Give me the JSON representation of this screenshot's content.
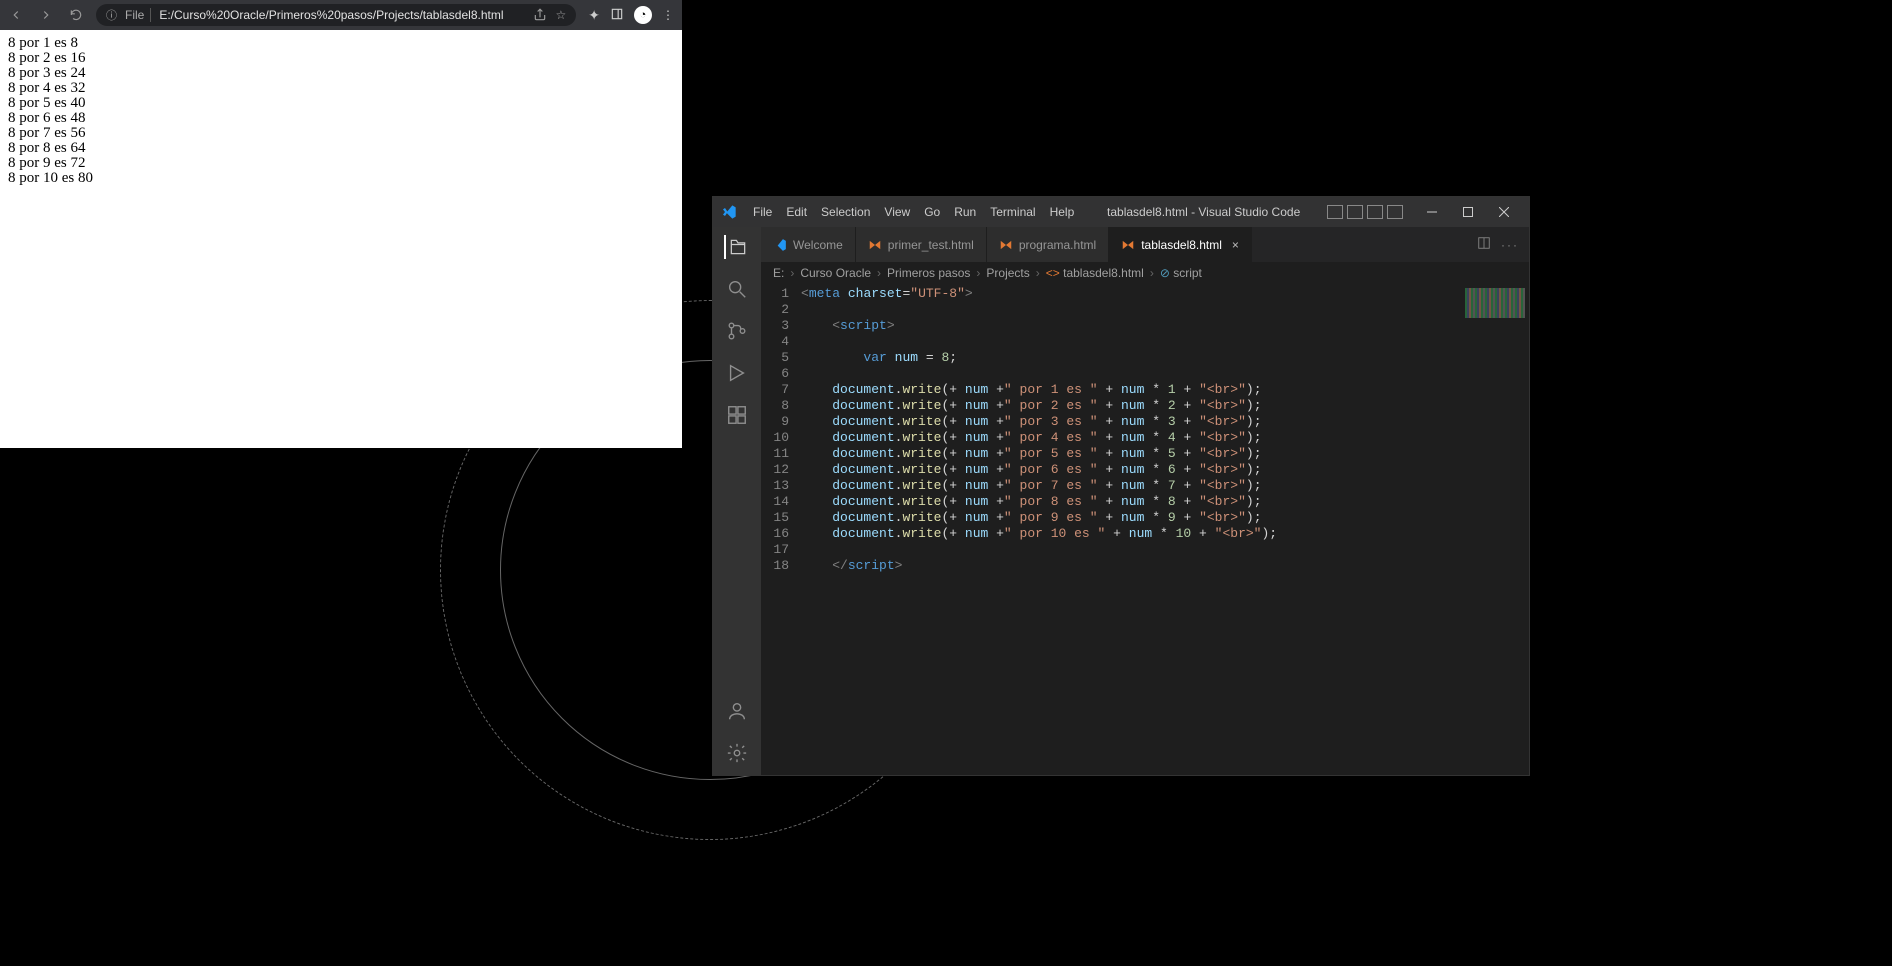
{
  "browser": {
    "url": "E:/Curso%20Oracle/Primeros%20pasos/Projects/tablasdel8.html",
    "file_badge": "File",
    "output_lines": [
      "8 por 1 es 8",
      "8 por 2 es 16",
      "8 por 3 es 24",
      "8 por 4 es 32",
      "8 por 5 es 40",
      "8 por 6 es 48",
      "8 por 7 es 56",
      "8 por 8 es 64",
      "8 por 9 es 72",
      "8 por 10 es 80"
    ]
  },
  "vscode": {
    "title": "tablasdel8.html - Visual Studio Code",
    "menu": [
      "File",
      "Edit",
      "Selection",
      "View",
      "Go",
      "Run",
      "Terminal",
      "Help"
    ],
    "tabs": [
      {
        "label": "Welcome",
        "icon": "vscode"
      },
      {
        "label": "primer_test.html",
        "icon": "html"
      },
      {
        "label": "programa.html",
        "icon": "html"
      },
      {
        "label": "tablasdel8.html",
        "icon": "html",
        "active": true
      }
    ],
    "breadcrumbs": [
      "E:",
      "Curso Oracle",
      "Primeros pasos",
      "Projects",
      "tablasdel8.html",
      "script"
    ],
    "line_numbers": [
      "1",
      "2",
      "3",
      "4",
      "5",
      "6",
      "7",
      "8",
      "9",
      "10",
      "11",
      "12",
      "13",
      "14",
      "15",
      "16",
      "17",
      "18"
    ],
    "code": {
      "num_var": "num",
      "num_val": "8",
      "lines": [
        {
          "mult": "1"
        },
        {
          "mult": "2"
        },
        {
          "mult": "3"
        },
        {
          "mult": "4"
        },
        {
          "mult": "5"
        },
        {
          "mult": "6"
        },
        {
          "mult": "7"
        },
        {
          "mult": "8"
        },
        {
          "mult": "9"
        },
        {
          "mult": "10"
        }
      ]
    }
  }
}
